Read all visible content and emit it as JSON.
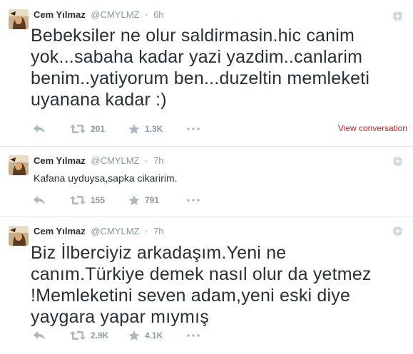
{
  "tweets": [
    {
      "fullname": "Cem Yılmaz",
      "username": "@CMYLMZ",
      "dot": "·",
      "time": "6h",
      "text": "Bebeksiler ne olur saldirmasin.hic canim yok...sabaha kadar yazi yazdim..canlarim benim..yatiyorum ben...duzeltin memleketi uyanana kadar :)",
      "retweets": "201",
      "favorites": "1.3K",
      "view_conversation": "View conversation"
    },
    {
      "fullname": "Cem Yılmaz",
      "username": "@CMYLMZ",
      "dot": "·",
      "time": "7h",
      "text": "Kafana uyduysa,sapka cikaririm.",
      "retweets": "155",
      "favorites": "791"
    },
    {
      "fullname": "Cem Yılmaz",
      "username": "@CMYLMZ",
      "dot": "·",
      "time": "7h",
      "text": "Biz İlberciyiz arkadaşım.Yeni ne canım.Türkiye demek nasıl olur da yetmez !Memleketini seven adam,yeni eski diye yaygara yapar mıymış",
      "retweets": "2.9K",
      "favorites": "4.1K"
    }
  ],
  "icons": {
    "reply": "reply-icon",
    "retweet": "retweet-icon",
    "favorite": "star-icon",
    "more": "more-dots-icon",
    "options": "gear-icon"
  },
  "colors": {
    "text": "#292f33",
    "muted": "#8899a6",
    "icon": "#aab8c2",
    "divider": "#e1e8ed",
    "link": "#b22a2a"
  }
}
